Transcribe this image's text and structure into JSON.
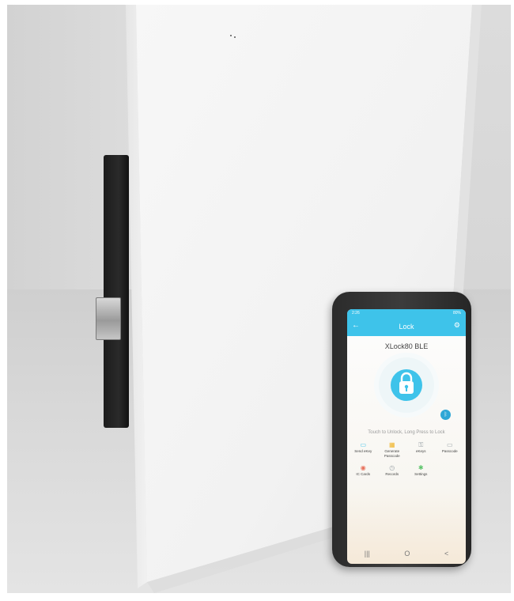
{
  "phone_app": {
    "status_left": "2:26",
    "status_right": "80%",
    "title": "Lock",
    "lock_name": "XLock80 BLE",
    "hint": "Touch to Unlock, Long Press to Lock",
    "menu": [
      {
        "label": "Send eKey",
        "icon": "send-ekey-icon",
        "glyph": "▭",
        "color": "#3ec3ea"
      },
      {
        "label": "Generate Passcode",
        "icon": "passcode-generate-icon",
        "glyph": "▦",
        "color": "#f0b429"
      },
      {
        "label": "eKeys",
        "icon": "ekeys-icon",
        "glyph": "⚿",
        "color": "#9aa3a8"
      },
      {
        "label": "Passcode",
        "icon": "passcode-icon",
        "glyph": "▭",
        "color": "#9aa3a8"
      },
      {
        "label": "IC Cards",
        "icon": "ic-card-icon",
        "glyph": "◉",
        "color": "#e8715c"
      },
      {
        "label": "Records",
        "icon": "records-icon",
        "glyph": "◷",
        "color": "#9aa3a8"
      },
      {
        "label": "Settings",
        "icon": "settings-icon",
        "glyph": "✱",
        "color": "#5cc46a"
      }
    ],
    "nav": [
      "|||",
      "O",
      "<"
    ],
    "accent": "#3ec3ea"
  }
}
